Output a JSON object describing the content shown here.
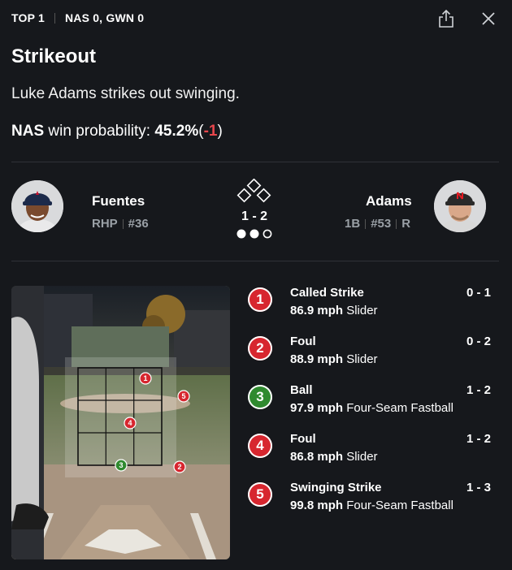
{
  "header": {
    "inning": "TOP 1",
    "score": "NAS 0, GWN 0"
  },
  "icons": {
    "share": "share-icon",
    "close": "close-icon"
  },
  "play": {
    "title": "Strikeout",
    "description": "Luke Adams strikes out swinging.",
    "win_team": "NAS",
    "win_label": "win probability:",
    "win_value": "45.2%",
    "win_open": "(",
    "win_change": "-1",
    "win_close": ")"
  },
  "pitcher": {
    "name": "Fuentes",
    "hand": "RHP",
    "number": "#36",
    "cap_color": "#1c2a4a",
    "cap_letter": "A"
  },
  "batter": {
    "name": "Adams",
    "position": "1B",
    "number": "#53",
    "bats": "R",
    "cap_color": "#2a2a2a",
    "cap_letter": "N"
  },
  "count": {
    "text": "1 - 2",
    "outs_filled": 2,
    "outs_total": 3
  },
  "colors": {
    "strike": "#d7262f",
    "ball": "#2f8a2f",
    "negative": "#e8474c"
  },
  "pitches": [
    {
      "num": "1",
      "result": "Called Strike",
      "count": "0 - 1",
      "speed": "86.9 mph",
      "type": "Slider",
      "kind": "strike"
    },
    {
      "num": "2",
      "result": "Foul",
      "count": "0 - 2",
      "speed": "88.9 mph",
      "type": "Slider",
      "kind": "strike"
    },
    {
      "num": "3",
      "result": "Ball",
      "count": "1 - 2",
      "speed": "97.9 mph",
      "type": "Four-Seam Fastball",
      "kind": "ball"
    },
    {
      "num": "4",
      "result": "Foul",
      "count": "1 - 2",
      "speed": "86.8 mph",
      "type": "Slider",
      "kind": "strike"
    },
    {
      "num": "5",
      "result": "Swinging Strike",
      "count": "1 - 3",
      "speed": "99.8 mph",
      "type": "Four-Seam Fastball",
      "kind": "strike"
    }
  ]
}
